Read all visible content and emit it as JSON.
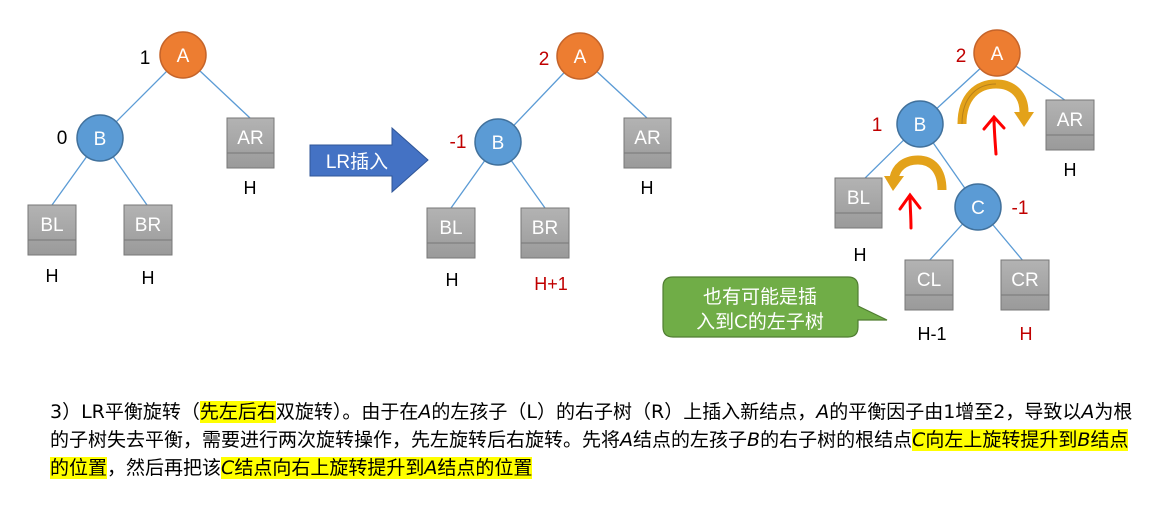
{
  "colors": {
    "orange": "#ED7D31",
    "blue": "#5B9BD5",
    "gray_box": "#A5A5A5",
    "arrow_fill": "#4472C4",
    "callout_fill": "#70AD47",
    "red_text": "#C00000",
    "highlight": "#FFFF00",
    "rotate_arrow": "#E3A21A"
  },
  "diagram1": {
    "A": {
      "label": "A",
      "bf": "1"
    },
    "B": {
      "label": "B",
      "bf": "0"
    },
    "AR": {
      "label": "AR",
      "h": "H"
    },
    "BL": {
      "label": "BL",
      "h": "H"
    },
    "BR": {
      "label": "BR",
      "h": "H"
    }
  },
  "transition_arrow": {
    "label": "LR插入"
  },
  "diagram2": {
    "A": {
      "label": "A",
      "bf": "2"
    },
    "B": {
      "label": "B",
      "bf": "-1"
    },
    "AR": {
      "label": "AR",
      "h": "H"
    },
    "BL": {
      "label": "BL",
      "h": "H"
    },
    "BR": {
      "label": "BR",
      "h": "H+1"
    }
  },
  "diagram3": {
    "A": {
      "label": "A",
      "bf": "2"
    },
    "B": {
      "label": "B",
      "bf": "1"
    },
    "C": {
      "label": "C",
      "bf": "-1"
    },
    "AR": {
      "label": "AR",
      "h": "H"
    },
    "BL": {
      "label": "BL",
      "h": "H"
    },
    "CL": {
      "label": "CL",
      "h": "H-1"
    },
    "CR": {
      "label": "CR",
      "h": "H"
    }
  },
  "callout": {
    "line1": "也有可能是插",
    "line2": "入到C的左子树"
  },
  "caption": {
    "p1": "3）LR平衡旋转（",
    "hl1": "先左后右",
    "p2": "双旋转）。由于在",
    "a1": "A",
    "p3": "的左孩子（L）的右子树（R）上插入新结点，",
    "a2": "A",
    "p4": "的平衡因子由1增至2，导致以",
    "a3": "A",
    "p5": "为根的子树失去平衡，需要进行两次旋转操作，先左旋转后右旋转。先将",
    "a4": "A",
    "p6": "结点的左孩子",
    "b1": "B",
    "p7": "的右子树的根结点",
    "hl2c": "C",
    "hl2": "向左上旋转提升到",
    "hl2b": "B",
    "hl2e": "结点的位置",
    "p8": "，然后再把该",
    "hl3c": "C",
    "hl3": "结点向右上旋转提升到",
    "hl3a": "A",
    "hl3e": "结点的位置"
  }
}
